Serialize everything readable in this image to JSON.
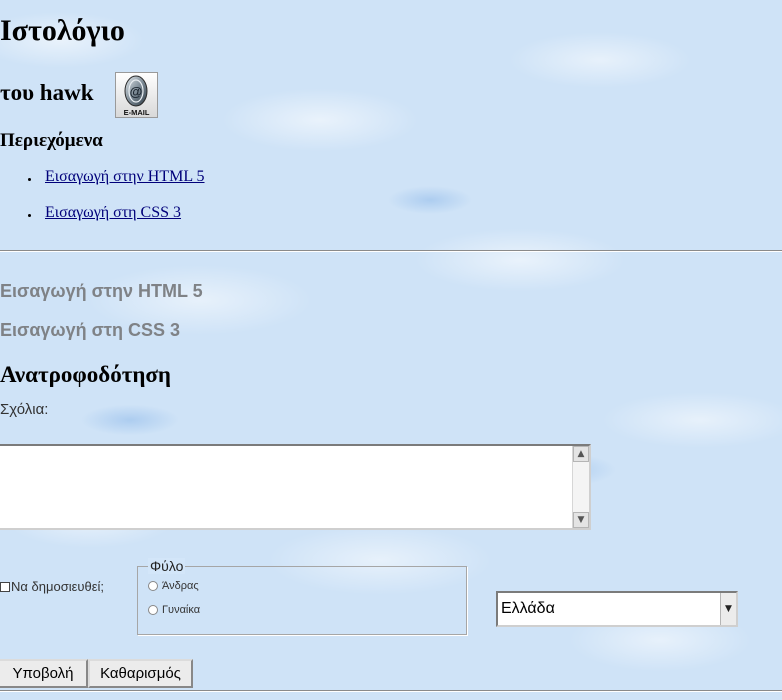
{
  "header": {
    "title": "Ιστολόγιο",
    "subtitle": "του hawk",
    "email_badge_text": "E-MAIL"
  },
  "toc": {
    "heading": "Περιεχόμενα",
    "items": [
      {
        "label": "Εισαγωγή στην HTML 5"
      },
      {
        "label": "Εισαγωγή στη CSS 3"
      }
    ]
  },
  "sections": [
    {
      "heading": "Εισαγωγή στην HTML 5"
    },
    {
      "heading": "Εισαγωγή στη CSS 3"
    }
  ],
  "feedback": {
    "heading": "Ανατροφοδότηση",
    "comments_label": "Σχόλια:",
    "comments_value": "",
    "publish_label": "Να δημοσιευθεί;",
    "publish_checked": false,
    "gender": {
      "legend": "Φύλο",
      "options": [
        "Άνδρας",
        "Γυναίκα"
      ],
      "selected": null
    },
    "country": {
      "selected": "Ελλάδα"
    },
    "submit_label": "Υποβολή",
    "reset_label": "Καθαρισμός"
  },
  "icons": {
    "email": "email-icon",
    "scroll_up": "scroll-up-icon",
    "scroll_down": "scroll-down-icon",
    "dropdown": "chevron-down-icon"
  },
  "colors": {
    "background": "#cfe3f7",
    "link": "#00007a",
    "section_heading": "#7f8286"
  }
}
